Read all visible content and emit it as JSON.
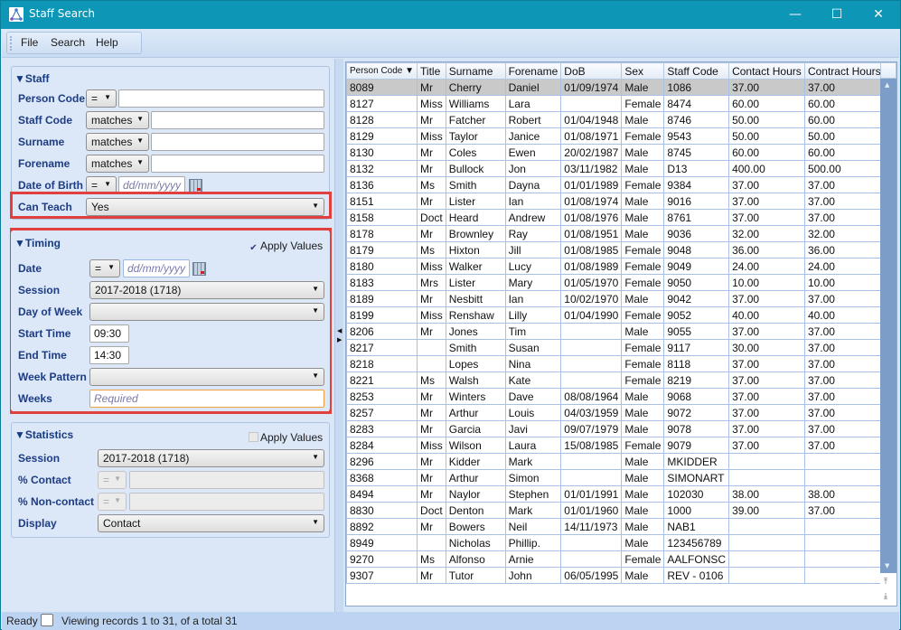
{
  "window": {
    "title": "Staff Search",
    "minimize_glyph": "—",
    "maximize_glyph": "☐",
    "close_glyph": "✕"
  },
  "menu": {
    "file": "File",
    "search": "Search",
    "help": "Help"
  },
  "staff": {
    "title": "▼Staff",
    "person_code_label": "Person Code",
    "person_code_op": "=",
    "person_code_value": "",
    "staff_code_label": "Staff Code",
    "staff_code_op": "matches",
    "staff_code_value": "",
    "surname_label": "Surname",
    "surname_op": "matches",
    "surname_value": "",
    "forename_label": "Forename",
    "forename_op": "matches",
    "forename_value": "",
    "dob_label": "Date of Birth",
    "dob_op": "=",
    "dob_placeholder": "dd/mm/yyyy",
    "can_teach_label": "Can Teach",
    "can_teach_value": "Yes"
  },
  "timing": {
    "title": "▼Timing",
    "apply_values_label": "Apply Values",
    "apply_values_checked": true,
    "date_label": "Date",
    "date_op": "=",
    "date_placeholder": "dd/mm/yyyy",
    "session_label": "Session",
    "session_value": "2017-2018 (1718)",
    "day_of_week_label": "Day of Week",
    "day_of_week_value": "",
    "start_time_label": "Start Time",
    "start_time_value": "09:30",
    "end_time_label": "End Time",
    "end_time_value": "14:30",
    "week_pattern_label": "Week Pattern",
    "week_pattern_value": "",
    "weeks_label": "Weeks",
    "weeks_placeholder": "Required"
  },
  "statistics": {
    "title": "▼Statistics",
    "apply_values_label": "Apply Values",
    "apply_values_checked": false,
    "session_label": "Session",
    "session_value": "2017-2018 (1718)",
    "contact_label": "% Contact",
    "contact_op": "=",
    "noncontact_label": "% Non-contact",
    "noncontact_op": "=",
    "display_label": "Display",
    "display_value": "Contact"
  },
  "grid": {
    "columns": [
      "Person Code ▼",
      "Title",
      "Surname",
      "Forename",
      "DoB",
      "Sex",
      "Staff Code",
      "Contact Hours",
      "Contract Hours"
    ],
    "rows": [
      [
        "8089",
        "Mr",
        "Cherry",
        "Daniel",
        "01/09/1974",
        "Male",
        "1086",
        "37.00",
        "37.00"
      ],
      [
        "8127",
        "Miss",
        "Williams",
        "Lara",
        "",
        "Female",
        "8474",
        "60.00",
        "60.00"
      ],
      [
        "8128",
        "Mr",
        "Fatcher",
        "Robert",
        "01/04/1948",
        "Male",
        "8746",
        "50.00",
        "60.00"
      ],
      [
        "8129",
        "Miss",
        "Taylor",
        "Janice",
        "01/08/1971",
        "Female",
        "9543",
        "50.00",
        "50.00"
      ],
      [
        "8130",
        "Mr",
        "Coles",
        "Ewen",
        "20/02/1987",
        "Male",
        "8745",
        "60.00",
        "60.00"
      ],
      [
        "8132",
        "Mr",
        "Bullock",
        "Jon",
        "03/11/1982",
        "Male",
        "D13",
        "400.00",
        "500.00"
      ],
      [
        "8136",
        "Ms",
        "Smith",
        "Dayna",
        "01/01/1989",
        "Female",
        "9384",
        "37.00",
        "37.00"
      ],
      [
        "8151",
        "Mr",
        "Lister",
        "Ian",
        "01/08/1974",
        "Male",
        "9016",
        "37.00",
        "37.00"
      ],
      [
        "8158",
        "Doct",
        "Heard",
        "Andrew",
        "01/08/1976",
        "Male",
        "8761",
        "37.00",
        "37.00"
      ],
      [
        "8178",
        "Mr",
        "Brownley",
        "Ray",
        "01/08/1951",
        "Male",
        "9036",
        "32.00",
        "32.00"
      ],
      [
        "8179",
        "Ms",
        "Hixton",
        "Jill",
        "01/08/1985",
        "Female",
        "9048",
        "36.00",
        "36.00"
      ],
      [
        "8180",
        "Miss",
        "Walker",
        "Lucy",
        "01/08/1989",
        "Female",
        "9049",
        "24.00",
        "24.00"
      ],
      [
        "8183",
        "Mrs",
        "Lister",
        "Mary",
        "01/05/1970",
        "Female",
        "9050",
        "10.00",
        "10.00"
      ],
      [
        "8189",
        "Mr",
        "Nesbitt",
        "Ian",
        "10/02/1970",
        "Male",
        "9042",
        "37.00",
        "37.00"
      ],
      [
        "8199",
        "Miss",
        "Renshaw",
        "Lilly",
        "01/04/1990",
        "Female",
        "9052",
        "40.00",
        "40.00"
      ],
      [
        "8206",
        "Mr",
        "Jones",
        "Tim",
        "",
        "Male",
        "9055",
        "37.00",
        "37.00"
      ],
      [
        "8217",
        "",
        "Smith",
        "Susan",
        "",
        "Female",
        "9117",
        "30.00",
        "37.00"
      ],
      [
        "8218",
        "",
        "Lopes",
        "Nina",
        "",
        "Female",
        "8118",
        "37.00",
        "37.00"
      ],
      [
        "8221",
        "Ms",
        "Walsh",
        "Kate",
        "",
        "Female",
        "8219",
        "37.00",
        "37.00"
      ],
      [
        "8253",
        "Mr",
        "Winters",
        "Dave",
        "08/08/1964",
        "Male",
        "9068",
        "37.00",
        "37.00"
      ],
      [
        "8257",
        "Mr",
        "Arthur",
        "Louis",
        "04/03/1959",
        "Male",
        "9072",
        "37.00",
        "37.00"
      ],
      [
        "8283",
        "Mr",
        "Garcia",
        "Javi",
        "09/07/1979",
        "Male",
        "9078",
        "37.00",
        "37.00"
      ],
      [
        "8284",
        "Miss",
        "Wilson",
        "Laura",
        "15/08/1985",
        "Female",
        "9079",
        "37.00",
        "37.00"
      ],
      [
        "8296",
        "Mr",
        "Kidder",
        "Mark",
        "",
        "Male",
        "MKIDDER",
        "",
        ""
      ],
      [
        "8368",
        "Mr",
        "Arthur",
        "Simon",
        "",
        "Male",
        "SIMONART",
        "",
        ""
      ],
      [
        "8494",
        "Mr",
        "Naylor",
        "Stephen",
        "01/01/1991",
        "Male",
        "102030",
        "38.00",
        "38.00"
      ],
      [
        "8830",
        "Doct",
        "Denton",
        "Mark",
        "01/01/1960",
        "Male",
        "1000",
        "39.00",
        "37.00"
      ],
      [
        "8892",
        "Mr",
        "Bowers",
        "Neil",
        "14/11/1973",
        "Male",
        "NAB1",
        "",
        ""
      ],
      [
        "8949",
        "",
        "Nicholas",
        "Phillip.",
        "",
        "Male",
        "123456789",
        "",
        ""
      ],
      [
        "9270",
        "Ms",
        "Alfonso",
        "Arnie",
        "",
        "Female",
        "AALFONSC",
        "",
        ""
      ],
      [
        "9307",
        "Mr",
        "Tutor",
        "John",
        "06/05/1995",
        "Male",
        "REV - 0106",
        "",
        ""
      ]
    ],
    "selected_row": 0
  },
  "status": {
    "ready": "Ready",
    "message": "Viewing records 1 to 31, of a total 31"
  }
}
